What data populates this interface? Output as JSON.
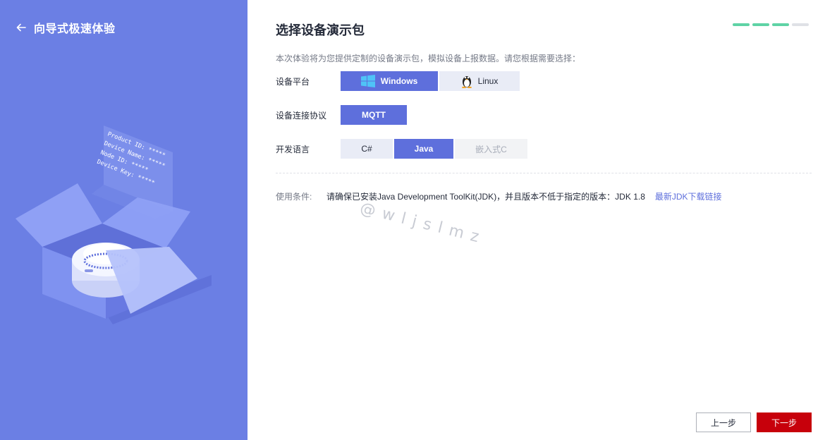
{
  "sidebar": {
    "back_icon": "arrow-left-icon",
    "title": "向导式极速体验",
    "card": {
      "lines": [
        "Product ID: *****",
        "Device Name: *****",
        "Node ID: *****",
        "Device Key: *****"
      ]
    }
  },
  "main": {
    "title": "选择设备演示包",
    "steps": [
      {
        "state": "done",
        "color": "#5fd3a5"
      },
      {
        "state": "done",
        "color": "#5fd3a5"
      },
      {
        "state": "current",
        "color": "#5fd3a5"
      },
      {
        "state": "todo",
        "color": "#dfe1e6"
      }
    ],
    "description": "本次体验将为您提供定制的设备演示包，模拟设备上报数据。请您根据需要选择：",
    "platform": {
      "label": "设备平台",
      "options": [
        {
          "label": "Windows",
          "icon": "windows-icon",
          "selected": true
        },
        {
          "label": "Linux",
          "icon": "linux-penguin-icon",
          "selected": false
        }
      ]
    },
    "protocol": {
      "label": "设备连接协议",
      "options": [
        {
          "label": "MQTT",
          "selected": true
        }
      ]
    },
    "language": {
      "label": "开发语言",
      "options": [
        {
          "label": "C#",
          "selected": false
        },
        {
          "label": "Java",
          "selected": true
        },
        {
          "label": "嵌入式C",
          "selected": false,
          "disabled": true
        }
      ]
    },
    "condition": {
      "label": "使用条件:",
      "text": "请确保已安装Java Development ToolKit(JDK)，并且版本不低于指定的版本：JDK 1.8",
      "link": "最新JDK下载链接"
    },
    "watermark": "@wljslmz"
  },
  "footer": {
    "prev_label": "上一步",
    "next_label": "下一步"
  },
  "colors": {
    "sidebar_bg": "#6b7fe4",
    "primary": "#5e6fdc",
    "step_done": "#5fd3a5",
    "next_button": "#c7000b"
  }
}
